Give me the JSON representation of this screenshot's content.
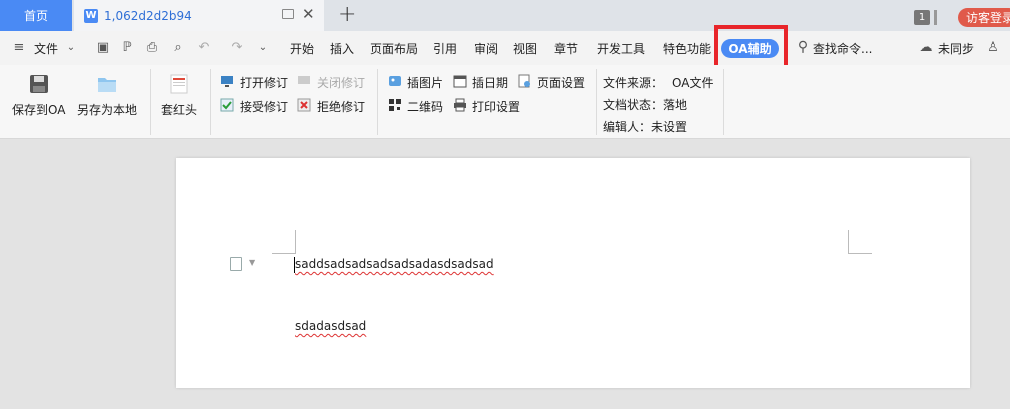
{
  "tabs": {
    "home": "首页",
    "doc_icon": "W",
    "doc_title": "1,062d2d2b94",
    "plus": "+",
    "close": "✕",
    "badge": "1",
    "login": "访客登录"
  },
  "menu": {
    "file": "文件",
    "items": [
      "开始",
      "插入",
      "页面布局",
      "引用",
      "审阅",
      "视图",
      "章节",
      "开发工具",
      "特色功能"
    ],
    "oa": "OA辅助",
    "search": "查找命令...",
    "sync": "未同步"
  },
  "ribbon": {
    "save_oa": "保存到OA",
    "save_local": "另存为本地",
    "header": "套红头",
    "open_rev": "打开修订",
    "close_rev": "关闭修订",
    "accept_rev": "接受修订",
    "reject_rev": "拒绝修订",
    "insert_pic": "插图片",
    "insert_date": "插日期",
    "page_setup": "页面设置",
    "qrcode": "二维码",
    "print_setup": "打印设置",
    "source_label": "文件来源：",
    "source_value": "OA文件",
    "status_label": "文档状态：",
    "status_value": "落地",
    "editor_label": "编辑人：",
    "editor_value": "未设置"
  },
  "document": {
    "para1": "saddsadsadsadsadsadasdsadsad",
    "para2": "sdadasdsad"
  },
  "colors": {
    "accent": "#4a8af4",
    "highlight": "#e8252a",
    "login": "#e05a4a"
  }
}
